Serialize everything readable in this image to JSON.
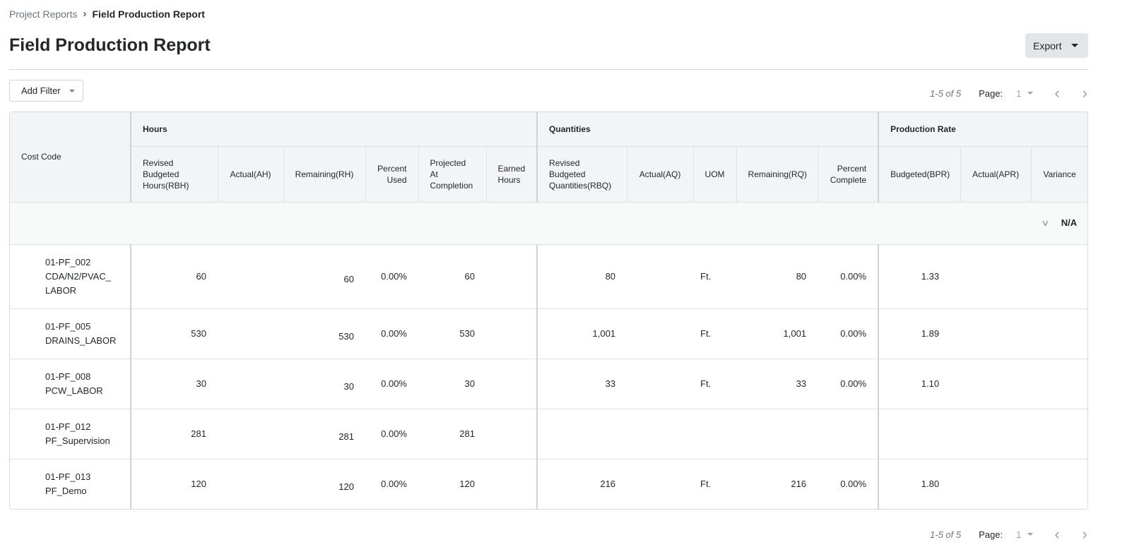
{
  "breadcrumb": {
    "parent": "Project Reports",
    "current": "Field Production Report"
  },
  "title": "Field Production Report",
  "export_label": "Export",
  "add_filter_label": "Add Filter",
  "pagination": {
    "count": "1-5 of 5",
    "page_label": "Page:",
    "page": "1"
  },
  "table": {
    "groups": {
      "cost_code": "Cost Code",
      "hours": "Hours",
      "quantities": "Quantities",
      "production_rate": "Production Rate"
    },
    "columns": [
      "Revised Budgeted Hours(RBH)",
      "Actual(AH)",
      "Remaining(RH)",
      "Percent Used",
      "Projected At Completion",
      "Earned Hours",
      "Revised Budgeted Quantities(RBQ)",
      "Actual(AQ)",
      "UOM",
      "Remaining(RQ)",
      "Percent Complete",
      "Budgeted(BPR)",
      "Actual(APR)",
      "Variance"
    ],
    "group_row": "N/A",
    "rows": [
      {
        "code": "01-PF_002",
        "name": "CDA/N2/PVAC_ LABOR",
        "rbh": "60",
        "ah": "",
        "rh": "60",
        "pu": "0.00%",
        "pac": "60",
        "eh": "",
        "rbq": "80",
        "aq": "",
        "uom": "Ft.",
        "rq": "80",
        "pc": "0.00%",
        "bpr": "1.33",
        "apr": "",
        "var": ""
      },
      {
        "code": "01-PF_005",
        "name": "DRAINS_LABOR",
        "rbh": "530",
        "ah": "",
        "rh": "530",
        "pu": "0.00%",
        "pac": "530",
        "eh": "",
        "rbq": "1,001",
        "aq": "",
        "uom": "Ft.",
        "rq": "1,001",
        "pc": "0.00%",
        "bpr": "1.89",
        "apr": "",
        "var": ""
      },
      {
        "code": "01-PF_008",
        "name": "PCW_LABOR",
        "rbh": "30",
        "ah": "",
        "rh": "30",
        "pu": "0.00%",
        "pac": "30",
        "eh": "",
        "rbq": "33",
        "aq": "",
        "uom": "Ft.",
        "rq": "33",
        "pc": "0.00%",
        "bpr": "1.10",
        "apr": "",
        "var": ""
      },
      {
        "code": "01-PF_012",
        "name": "PF_Supervision",
        "rbh": "281",
        "ah": "",
        "rh": "281",
        "pu": "0.00%",
        "pac": "281",
        "eh": "",
        "rbq": "",
        "aq": "",
        "uom": "",
        "rq": "",
        "pc": "",
        "bpr": "",
        "apr": "",
        "var": ""
      },
      {
        "code": "01-PF_013",
        "name": "PF_Demo",
        "rbh": "120",
        "ah": "",
        "rh": "120",
        "pu": "0.00%",
        "pac": "120",
        "eh": "",
        "rbq": "216",
        "aq": "",
        "uom": "Ft.",
        "rq": "216",
        "pc": "0.00%",
        "bpr": "1.80",
        "apr": "",
        "var": ""
      }
    ]
  }
}
